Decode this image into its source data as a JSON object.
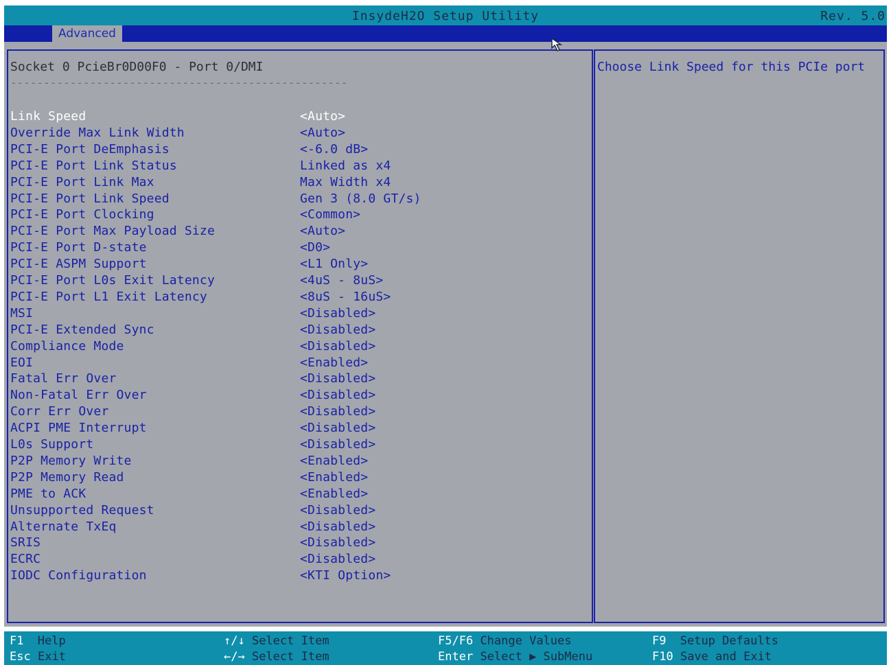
{
  "header": {
    "app_title": "InsydeH2O Setup Utility",
    "revision": "Rev. 5.0"
  },
  "menu": {
    "tabs": [
      {
        "label": "Advanced",
        "active": true
      }
    ]
  },
  "page": {
    "title": "Socket 0 PcieBr0D00F0 - Port 0/DMI",
    "divider": "---------------------------------------------------"
  },
  "settings": [
    {
      "label": "Link Speed",
      "value": "<Auto>",
      "selected": true
    },
    {
      "label": "Override Max Link Width",
      "value": "<Auto>"
    },
    {
      "label": "PCI-E Port DeEmphasis",
      "value": "<-6.0 dB>"
    },
    {
      "label": "PCI-E Port Link Status",
      "value": "Linked as x4"
    },
    {
      "label": "PCI-E Port Link Max",
      "value": "Max Width x4"
    },
    {
      "label": "PCI-E Port Link Speed",
      "value": "Gen 3 (8.0 GT/s)"
    },
    {
      "label": "PCI-E Port Clocking",
      "value": "<Common>"
    },
    {
      "label": "PCI-E Port Max Payload Size",
      "value": "<Auto>"
    },
    {
      "label": "PCI-E Port D-state",
      "value": "<D0>"
    },
    {
      "label": "PCI-E ASPM Support",
      "value": "<L1 Only>"
    },
    {
      "label": "PCI-E Port L0s Exit Latency",
      "value": "<4uS - 8uS>"
    },
    {
      "label": "PCI-E Port L1 Exit Latency",
      "value": "<8uS - 16uS>"
    },
    {
      "label": "MSI",
      "value": "<Disabled>"
    },
    {
      "label": "PCI-E Extended Sync",
      "value": "<Disabled>"
    },
    {
      "label": "Compliance Mode",
      "value": "<Disabled>"
    },
    {
      "label": "EOI",
      "value": "<Enabled>"
    },
    {
      "label": "Fatal Err Over",
      "value": "<Disabled>"
    },
    {
      "label": "Non-Fatal Err Over",
      "value": "<Disabled>"
    },
    {
      "label": "Corr Err Over",
      "value": "<Disabled>"
    },
    {
      "label": "ACPI PME Interrupt",
      "value": "<Disabled>"
    },
    {
      "label": "L0s Support",
      "value": "<Disabled>"
    },
    {
      "label": "P2P Memory Write",
      "value": "<Enabled>"
    },
    {
      "label": "P2P Memory Read",
      "value": "<Enabled>"
    },
    {
      "label": "PME to ACK",
      "value": "<Enabled>"
    },
    {
      "label": "Unsupported Request",
      "value": "<Disabled>"
    },
    {
      "label": "Alternate TxEq",
      "value": "<Disabled>"
    },
    {
      "label": "SRIS",
      "value": "<Disabled>"
    },
    {
      "label": "ECRC",
      "value": "<Disabled>"
    },
    {
      "label": "IODC Configuration",
      "value": "<KTI Option>"
    }
  ],
  "help": {
    "text": "Choose Link Speed for this PCIe port"
  },
  "footer": {
    "keys": [
      {
        "key": "F1",
        "desc": "Help"
      },
      {
        "key": "Esc",
        "desc": "Exit"
      },
      {
        "key": "↑/↓",
        "desc": "Select Item"
      },
      {
        "key": "←/→",
        "desc": "Select Item"
      },
      {
        "key": "F5/F6",
        "desc": "Change Values"
      },
      {
        "key": "Enter",
        "desc": "Select ▶ SubMenu"
      },
      {
        "key": "F9",
        "desc": "Setup Defaults"
      },
      {
        "key": "F10",
        "desc": "Save and Exit"
      }
    ]
  },
  "colors": {
    "title_bar": "#0f8fab",
    "menu_bar": "#101ea8",
    "panel_bg": "#a3a6ad",
    "text_blue": "#1a22a6",
    "selected_text": "#ffffff"
  }
}
